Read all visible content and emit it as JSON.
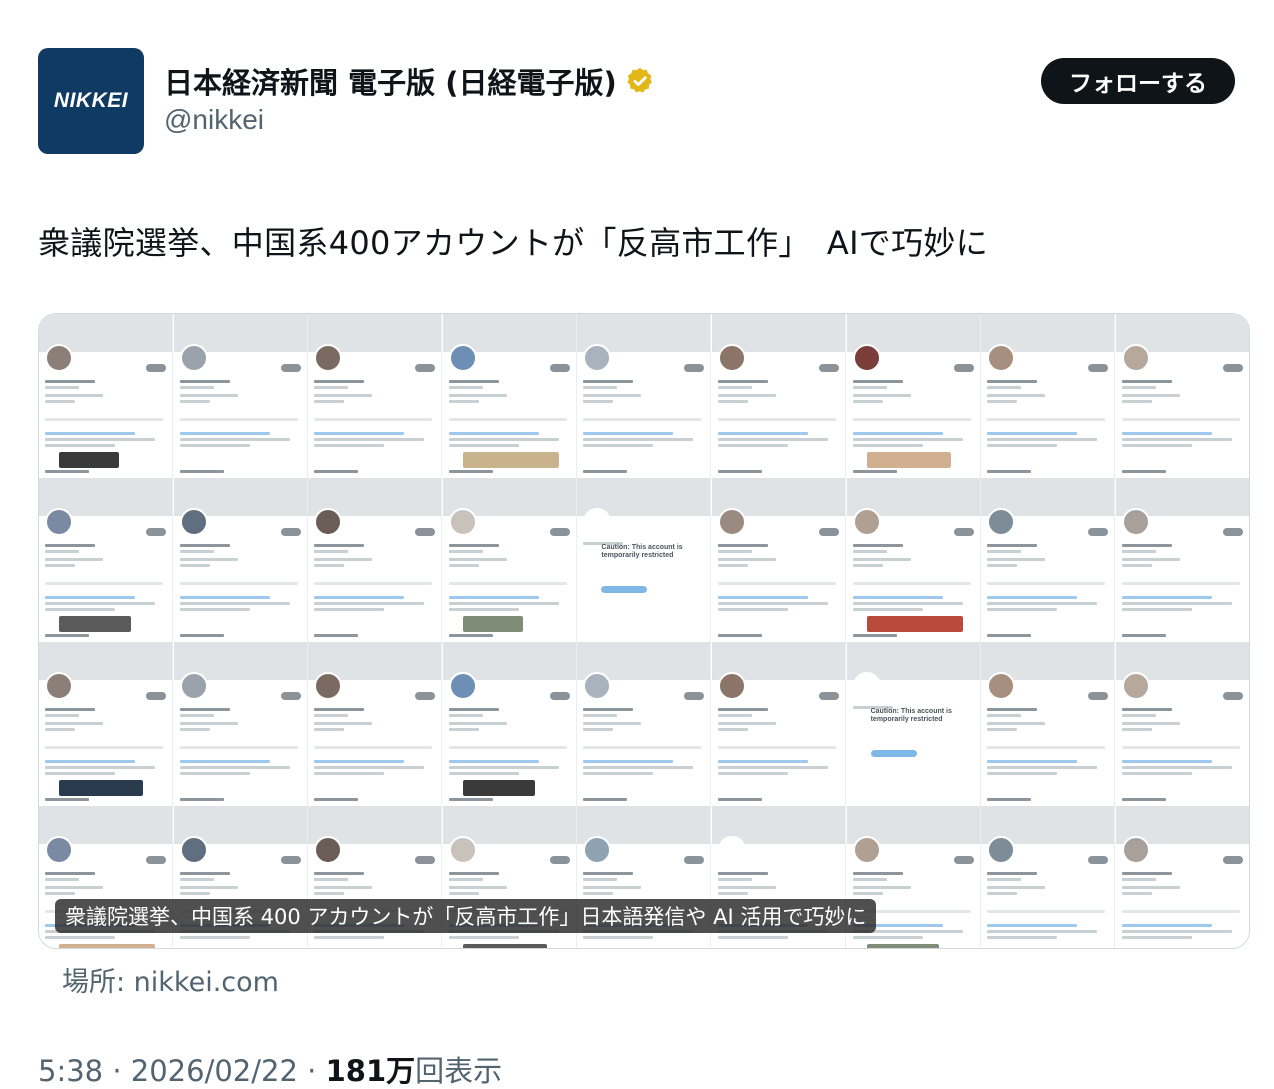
{
  "account": {
    "avatar_text": "NIKKEI",
    "display_name": "日本経済新聞 電子版 (日経電子版)",
    "handle": "@nikkei",
    "verified_badge": "gold-verified-icon",
    "follow_label": "フォローする"
  },
  "tweet": {
    "text": "衆議院選挙、中国系400アカウントが「反高市工作」　AIで巧妙に"
  },
  "card": {
    "caption": "衆議院選挙、中国系 400 アカウントが「反高市工作」日本語発信や AI 活用で巧妙に",
    "caution_title": "Caution: This account is temporarily restricted"
  },
  "source": {
    "label": "場所: nikkei.com"
  },
  "meta": {
    "time_date": "5:38 · 2026/02/22 · ",
    "views_count": "181万",
    "views_label": "回表示"
  },
  "colors": {
    "brand_navy": "#0e3a63",
    "verified_gold": "#e2b719",
    "text_primary": "#0f1419",
    "text_secondary": "#536471"
  }
}
